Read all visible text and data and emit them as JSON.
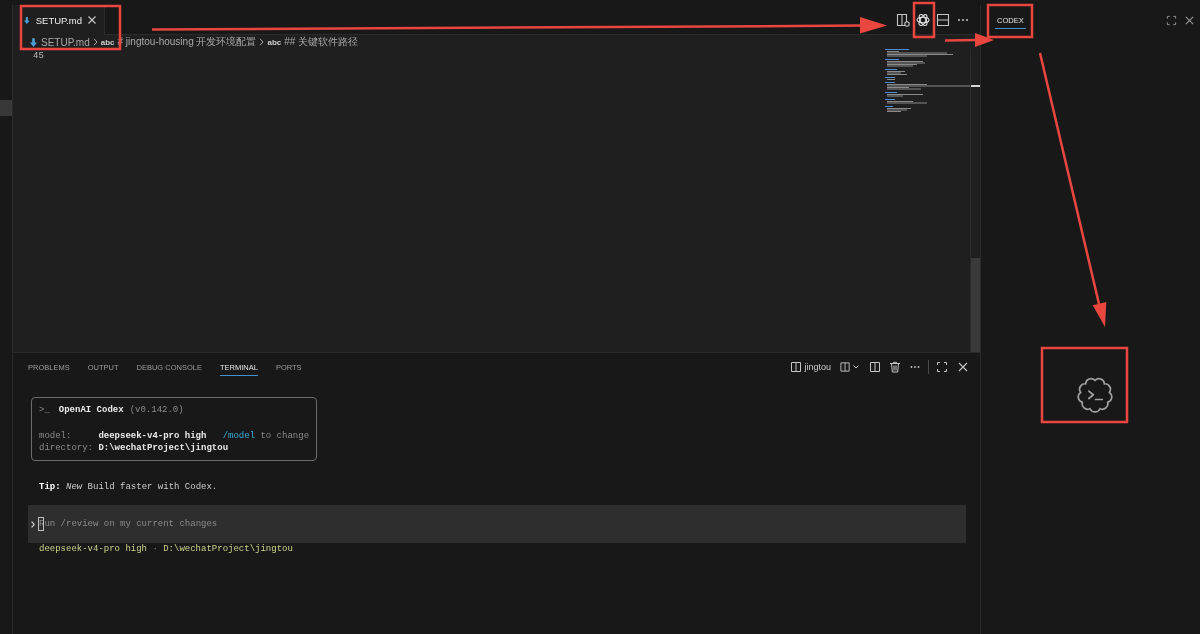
{
  "editor": {
    "tabs": [
      {
        "label": "SETUP.md",
        "selected": true
      }
    ],
    "breadcrumb": [
      {
        "kind": "file",
        "label": "SETUP.md"
      },
      {
        "kind": "symbol",
        "type_tag": "abc",
        "label": "# jingtou-housing 开发环境配置"
      },
      {
        "kind": "symbol",
        "type_tag": "abc",
        "label": "## 关键软件路径"
      }
    ],
    "line_numbers": [
      "45"
    ]
  },
  "panel": {
    "tabs": [
      {
        "label": "PROBLEMS",
        "selected": false
      },
      {
        "label": "OUTPUT",
        "selected": false
      },
      {
        "label": "DEBUG CONSOLE",
        "selected": false
      },
      {
        "label": "TERMINAL",
        "selected": true
      },
      {
        "label": "PORTS",
        "selected": false
      }
    ],
    "terminal_name": "jingtou",
    "terminal": {
      "banner": {
        "prompt": ">_",
        "title": "OpenAI Codex",
        "version": "(v0.142.0)",
        "rows": [
          {
            "label": "model:",
            "value": "deepseek-v4-pro high",
            "command": "/model",
            "note": "to change"
          },
          {
            "label": "directory:",
            "value": "D:\\wechatProject\\jingtou"
          }
        ]
      },
      "tip": "**Tip:** *New* Build faster with Codex.",
      "input": {
        "placeholder": "Run /review on my current changes"
      },
      "status": {
        "model": "deepseek-v4-pro high",
        "separator": "·",
        "path": "D:\\wechatProject\\jingtou"
      }
    }
  },
  "side_panel": {
    "tabs": [
      {
        "label": "CODEX",
        "selected": true
      }
    ]
  }
}
